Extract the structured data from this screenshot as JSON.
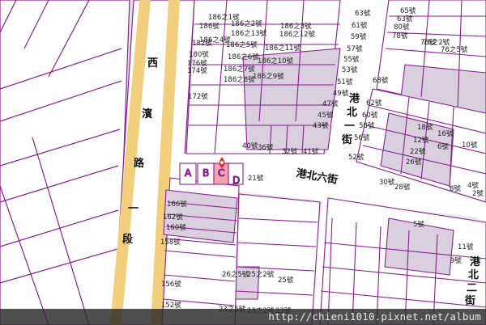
{
  "streets": {
    "west_road": [
      "西",
      "濱",
      "路",
      "一",
      "段"
    ],
    "north_first": [
      "港",
      "北",
      "一",
      "街"
    ],
    "north_sixth": "港北六街",
    "north_second": [
      "港",
      "北",
      "二",
      "街"
    ]
  },
  "lots": [
    "A",
    "B",
    "C",
    "D"
  ],
  "colors": {
    "parcel_line": "#8a1f8f",
    "parcel_fill": "#d9cfdf",
    "road_fill": "#ffffff",
    "map_background": "#e6e6e8",
    "west_road_stripe": "#f2cf7d",
    "highlight_lot": "#f3a3ad",
    "marker": "#d72b2b"
  },
  "house_numbers": [
    "186之1號",
    "186號",
    "186之2號",
    "186之3號",
    "186之4號",
    "186之13號",
    "186之12號",
    "186之11號",
    "186之10號",
    "182號",
    "186之5號",
    "180號",
    "186之6號",
    "176號",
    "186之7號",
    "174號",
    "186之8號",
    "186之9號",
    "172號",
    "63號",
    "61號",
    "59號",
    "57號",
    "55號",
    "53號",
    "51號",
    "49號",
    "47號",
    "45號",
    "43號",
    "62號",
    "60號",
    "58號",
    "56號",
    "52號",
    "30號",
    "28號",
    "40號",
    "36號",
    "32號",
    "41號",
    "21號",
    "65號",
    "63號",
    "80號",
    "78號",
    "76號",
    "76之2號",
    "76之5號",
    "68號",
    "18號",
    "16號",
    "12號",
    "22號",
    "26號",
    "6號",
    "10號",
    "8號",
    "2號",
    "4號",
    "166號",
    "162號",
    "160號",
    "158號",
    "156號",
    "152號",
    "26之5號",
    "25之2號",
    "25號",
    "23之5號",
    "23之2號",
    "23號",
    "5號",
    "11號",
    "9號"
  ],
  "watermark": "http://chieni1010.pixnet.net/album"
}
